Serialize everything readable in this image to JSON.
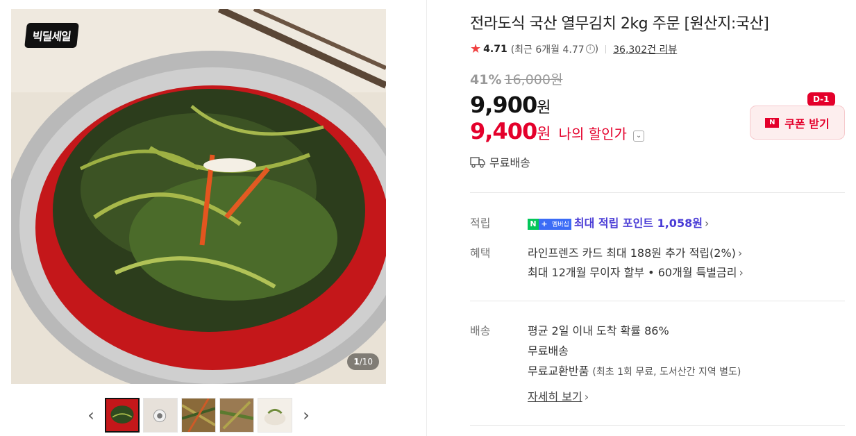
{
  "gallery": {
    "deal_badge": "빅딜세일",
    "counter_current": "1",
    "counter_total": "/10",
    "prev_icon": "chevron-left-icon",
    "next_icon": "chevron-right-icon"
  },
  "product": {
    "title": "전라도식 국산 열무김치 2kg 주문 [원산지:국산]",
    "rating": "4.71",
    "recent_rating": "(최근 6개월 4.77",
    "recent_close": ")",
    "review_count": "36,302건 리뷰",
    "discount_rate": "41%",
    "original_price": "16,000원",
    "sale_price": "9,900",
    "sale_unit": "원",
    "my_price": "9,400",
    "my_unit": "원",
    "my_price_label": "나의 할인가",
    "shipping_summary": "무료배송"
  },
  "coupon": {
    "d_badge": "D-1",
    "label": "쿠폰 받기",
    "icon": "N"
  },
  "benefits": {
    "points_label": "적립",
    "membership_mem": "멤버십",
    "points_text": "최대 적립 포인트 1,058원",
    "benefit_label": "혜택",
    "card_text": "라인프렌즈 카드 최대 188원 추가 적립(2%)",
    "installment_text": "최대 12개월 무이자 할부 • 60개월 특별금리"
  },
  "delivery": {
    "label": "배송",
    "arrival": "평균 2일 이내 도착 확률 86%",
    "free": "무료배송",
    "exchange": "무료교환반품",
    "exchange_note": "(최초 1회 무료, 도서산간 지역 별도)",
    "details_link": "자세히 보기"
  },
  "colors": {
    "accent_red": "#e4002b",
    "point_purple": "#4a3cd6",
    "naver_green": "#03c75a"
  }
}
